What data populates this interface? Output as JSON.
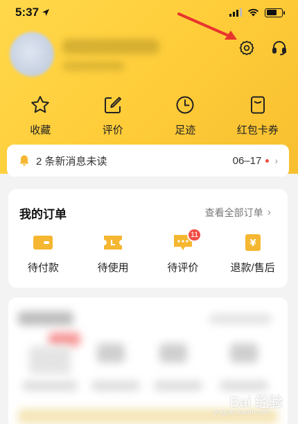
{
  "status_bar": {
    "time": "5:37"
  },
  "quick_links": [
    {
      "icon": "star-icon",
      "label": "收藏"
    },
    {
      "icon": "edit-icon",
      "label": "评价"
    },
    {
      "icon": "clock-icon",
      "label": "足迹"
    },
    {
      "icon": "wallet-icon",
      "label": "红包卡券"
    }
  ],
  "notice": {
    "text": "2 条新消息未读",
    "date": "06–17",
    "icon": "bell-icon"
  },
  "orders": {
    "title": "我的订单",
    "view_all": "查看全部订单",
    "items": [
      {
        "icon": "wallet-icon",
        "label": "待付款"
      },
      {
        "icon": "ticket-icon",
        "label": "待使用"
      },
      {
        "icon": "chat-icon",
        "label": "待评价",
        "badge": "11"
      },
      {
        "icon": "yen-icon",
        "label": "退款/售后"
      }
    ]
  },
  "watermark": {
    "text": "Bai 经验",
    "sub": "jingyan.baidu.com"
  },
  "colors": {
    "header_yellow": "#ffd84a",
    "accent_orange": "#f5b731",
    "badge_red": "#f14d43",
    "arrow_red": "#e8352e"
  }
}
